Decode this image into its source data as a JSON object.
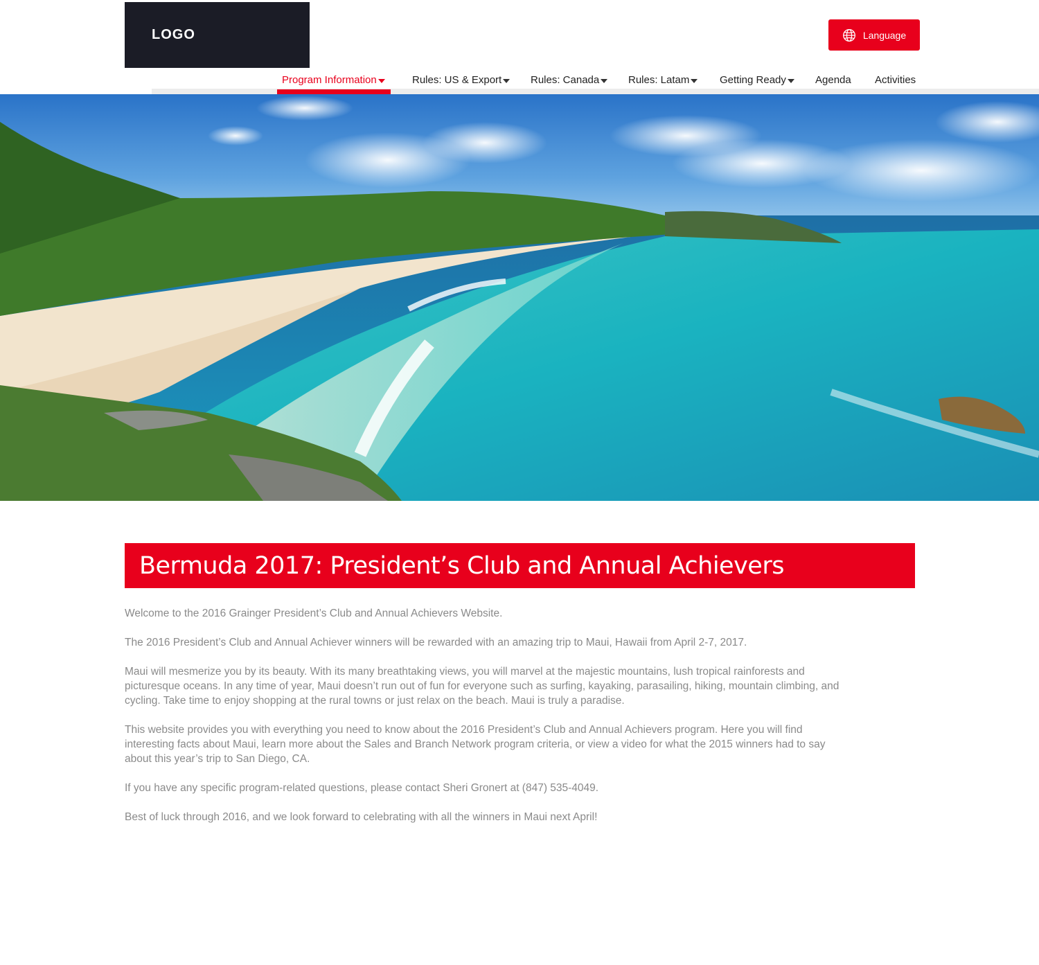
{
  "header": {
    "logo_text": "LOGO",
    "language_label": "Language"
  },
  "nav": {
    "items": [
      {
        "label": "Program Information",
        "dropdown": true,
        "active": true
      },
      {
        "label": "Rules: US & Export",
        "dropdown": true
      },
      {
        "label": "Rules: Canada",
        "dropdown": true
      },
      {
        "label": "Rules: Latam",
        "dropdown": true
      },
      {
        "label": "Getting Ready",
        "dropdown": true
      },
      {
        "label": "Agenda",
        "dropdown": false
      },
      {
        "label": "Activities",
        "dropdown": false
      }
    ]
  },
  "hero": {
    "icon": "beach-photo"
  },
  "main": {
    "title": "Bermuda 2017: President’s Club and Annual Achievers",
    "paragraphs": [
      "Welcome to the 2016 Grainger President’s Club and Annual Achievers Website.",
      "The 2016 President’s Club and Annual Achiever winners will be rewarded with an amazing trip to Maui, Hawaii from April 2-7, 2017.",
      "Maui will mesmerize you by its beauty. With its many breathtaking views, you will marvel at the majestic mountains, lush tropical rainforests and picturesque oceans. In any time of year, Maui doesn’t run out of fun for everyone such as surfing, kayaking, parasailing, hiking, mountain climbing, and cycling. Take time to enjoy shopping at the rural towns or just relax on the beach. Maui is truly a paradise.",
      "This website provides you with everything you need to know about the 2016 President’s Club and Annual Achievers program. Here you will find interesting facts about Maui, learn more about the Sales and Branch Network program criteria, or view a video for what the 2015 winners had to say about this year’s trip to San Diego, CA.",
      "If you have any specific program-related questions, please contact Sheri Gronert at (847) 535-4049.",
      "Best of luck through 2016, and we look forward to celebrating with all the winners in Maui next April!"
    ]
  },
  "colors": {
    "accent": "#e8001c",
    "logo_bg": "#1b1c26",
    "body_text": "#8a8a8a"
  }
}
